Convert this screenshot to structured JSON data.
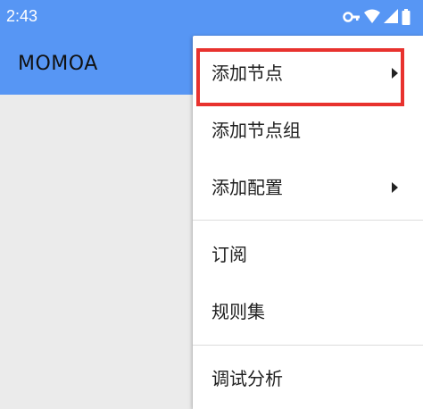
{
  "status_bar": {
    "time": "2:43",
    "icons": [
      "vpn-key-icon",
      "wifi-icon",
      "signal-icon",
      "battery-icon"
    ]
  },
  "app_bar": {
    "title": "MOMOA"
  },
  "menu": {
    "items": [
      {
        "label": "添加节点",
        "has_submenu": true,
        "highlighted": true
      },
      {
        "label": "添加节点组",
        "has_submenu": false
      },
      {
        "label": "添加配置",
        "has_submenu": true
      },
      {
        "label": "订阅",
        "has_submenu": false
      },
      {
        "label": "规则集",
        "has_submenu": false
      },
      {
        "label": "调试分析",
        "has_submenu": false
      }
    ]
  },
  "colors": {
    "primary": "#5796f4",
    "background": "#ebebeb",
    "menu_background": "#ffffff",
    "highlight_border": "#e8322e"
  }
}
